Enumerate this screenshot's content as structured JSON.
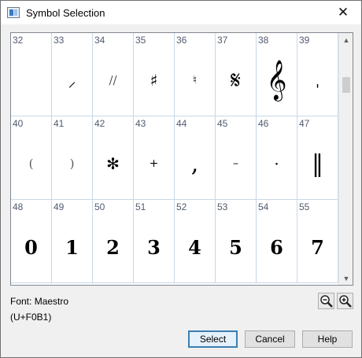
{
  "window": {
    "title": "Symbol Selection",
    "close_glyph": "✕",
    "app_icon": "symbol-app-icon"
  },
  "symbols": [
    {
      "code": "32",
      "glyph": "",
      "style": "g-small"
    },
    {
      "code": "33",
      "glyph": "⸝",
      "style": "g-mid"
    },
    {
      "code": "34",
      "glyph": "//",
      "style": "g-light"
    },
    {
      "code": "35",
      "glyph": "♯",
      "style": "g-mid"
    },
    {
      "code": "36",
      "glyph": "♮",
      "style": "g-small"
    },
    {
      "code": "37",
      "glyph": "𝄋",
      "style": "g-large"
    },
    {
      "code": "38",
      "glyph": "𝄞",
      "style": "g-huge"
    },
    {
      "code": "39",
      "glyph": "ˌ",
      "style": "g-mid"
    },
    {
      "code": "40",
      "glyph": "(",
      "style": "g-light"
    },
    {
      "code": "41",
      "glyph": ")",
      "style": "g-light"
    },
    {
      "code": "42",
      "glyph": "✻",
      "style": "g-mid"
    },
    {
      "code": "43",
      "glyph": "+",
      "style": "g-small"
    },
    {
      "code": "44",
      "glyph": ",",
      "style": "g-large"
    },
    {
      "code": "45",
      "glyph": "–",
      "style": "g-small"
    },
    {
      "code": "46",
      "glyph": "·",
      "style": "g-mid"
    },
    {
      "code": "47",
      "glyph": "‖",
      "style": "g-large"
    },
    {
      "code": "48",
      "glyph": "0",
      "style": "g-digit"
    },
    {
      "code": "49",
      "glyph": "1",
      "style": "g-digit"
    },
    {
      "code": "50",
      "glyph": "2",
      "style": "g-digit"
    },
    {
      "code": "51",
      "glyph": "3",
      "style": "g-digit"
    },
    {
      "code": "52",
      "glyph": "4",
      "style": "g-digit"
    },
    {
      "code": "53",
      "glyph": "5",
      "style": "g-digit"
    },
    {
      "code": "54",
      "glyph": "6",
      "style": "g-digit"
    },
    {
      "code": "55",
      "glyph": "7",
      "style": "g-digit"
    }
  ],
  "scrollbar": {
    "up_glyph": "▲",
    "down_glyph": "▼",
    "position": 0.06
  },
  "font_label": "Font:",
  "font_name": "Maestro",
  "unicode_code": "(U+F0B1)",
  "zoom": {
    "out_icon": "zoom-out-icon",
    "in_icon": "zoom-in-icon"
  },
  "buttons": {
    "select": "Select",
    "cancel": "Cancel",
    "help": "Help"
  },
  "colors": {
    "accent": "#3c7fb1",
    "grid_line": "#c9d8e8",
    "code_text": "#505a6e"
  }
}
